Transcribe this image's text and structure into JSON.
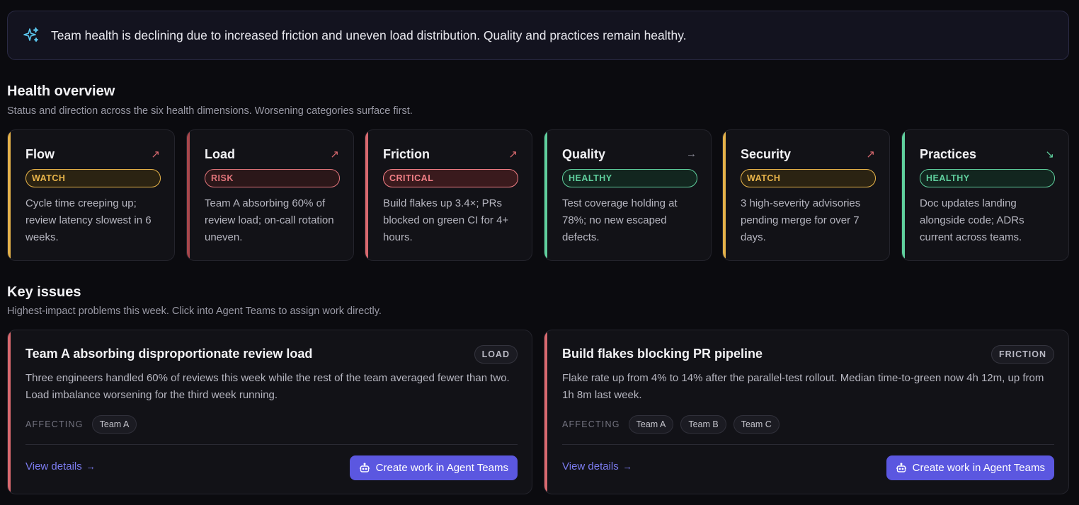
{
  "banner": {
    "icon": "sparkles-icon",
    "text": "Team health is declining due to increased friction and uneven load distribution. Quality and practices remain healthy."
  },
  "health": {
    "title": "Health overview",
    "subtitle": "Status and direction across the six health dimensions. Worsening categories surface first.",
    "cards": [
      {
        "name": "Flow",
        "status": "WATCH",
        "trend": "↗",
        "trend_icon": "trend-up-icon",
        "accent": "#e5b24a",
        "trend_color": "#d9696f",
        "description": "Cycle time creeping up; review latency slowest in 6 weeks."
      },
      {
        "name": "Load",
        "status": "RISK",
        "trend": "↗",
        "trend_icon": "trend-up-icon",
        "accent": "#a8474c",
        "trend_color": "#d9696f",
        "description": "Team A absorbing 60% of review load; on-call rotation uneven."
      },
      {
        "name": "Friction",
        "status": "CRITICAL",
        "trend": "↗",
        "trend_icon": "trend-up-icon",
        "accent": "#d9696f",
        "trend_color": "#d9696f",
        "description": "Build flakes up 3.4×; PRs blocked on green CI for 4+ hours."
      },
      {
        "name": "Quality",
        "status": "HEALTHY",
        "trend": "→",
        "trend_icon": "trend-flat-icon",
        "accent": "#5fcf9d",
        "trend_color": "#8a8a96",
        "description": "Test coverage holding at 78%; no new escaped defects."
      },
      {
        "name": "Security",
        "status": "WATCH",
        "trend": "↗",
        "trend_icon": "trend-up-icon",
        "accent": "#e5b24a",
        "trend_color": "#d9696f",
        "description": "3 high-severity advisories pending merge for over 7 days."
      },
      {
        "name": "Practices",
        "status": "HEALTHY",
        "trend": "↘",
        "trend_icon": "trend-down-icon",
        "accent": "#5fcf9d",
        "trend_color": "#5fcf9d",
        "description": "Doc updates landing alongside code; ADRs current across teams."
      }
    ]
  },
  "issues": {
    "title": "Key issues",
    "subtitle": "Highest-impact problems this week. Click into Agent Teams to assign work directly.",
    "items": [
      {
        "title": "Team A absorbing disproportionate review load",
        "tag": "LOAD",
        "body": "Three engineers handled 60% of reviews this week while the rest of the team averaged fewer than two. Load imbalance worsening for the third week running.",
        "affecting_label": "AFFECTING",
        "teams": [
          "Team A"
        ],
        "view_label": "View details",
        "cta_label": "Create work in Agent Teams"
      },
      {
        "title": "Build flakes blocking PR pipeline",
        "tag": "FRICTION",
        "body": "Flake rate up from 4% to 14% after the parallel-test rollout. Median time-to-green now 4h 12m, up from 1h 8m last week.",
        "affecting_label": "AFFECTING",
        "teams": [
          "Team A",
          "Team B",
          "Team C"
        ],
        "view_label": "View details",
        "cta_label": "Create work in Agent Teams"
      }
    ]
  }
}
